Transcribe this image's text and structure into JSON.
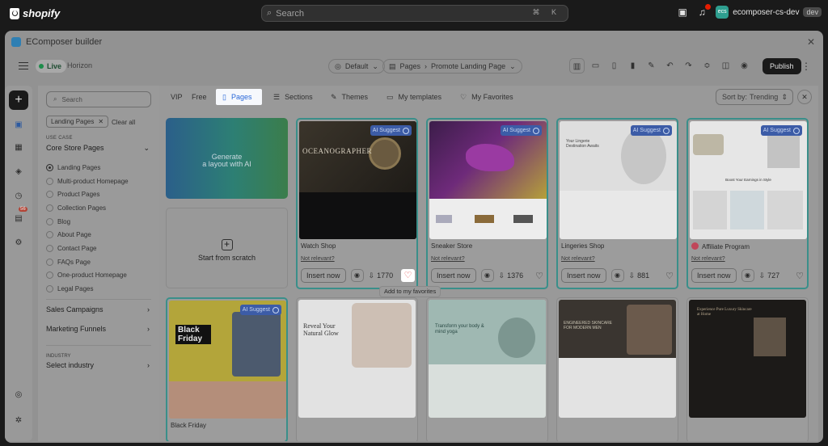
{
  "topbar": {
    "brand": "shopify",
    "search_placeholder": "Search",
    "kbd": "⌘ K",
    "account_name": "ecomposer-cs-dev",
    "account_avatar": "ecs",
    "account_tag": "dev"
  },
  "modal": {
    "title": "EComposer builder",
    "live_label": "Live",
    "theme_name": "Horizon",
    "device_label": "Default",
    "page_type": "Pages",
    "page_name": "Promote Landing Page",
    "publish_label": "Publish"
  },
  "rail": {
    "badge": "56"
  },
  "panel": {
    "search_placeholder": "Search",
    "chip_label": "Landing Pages",
    "clear_all": "Clear all",
    "use_case_label": "USE CASE",
    "group_title": "Core Store Pages",
    "options": [
      "Landing Pages",
      "Multi-product Homepage",
      "Product Pages",
      "Collection Pages",
      "Blog",
      "About Page",
      "Contact Page",
      "FAQs Page",
      "One-product Homepage",
      "Legal Pages"
    ],
    "selected_index": 0,
    "sales_campaigns": "Sales Campaigns",
    "marketing_funnels": "Marketing Funnels",
    "industry_label": "INDUSTRY",
    "select_industry": "Select industry"
  },
  "tabs": {
    "vip": "VIP",
    "free": "Free",
    "pages": "Pages",
    "sections": "Sections",
    "themes": "Themes",
    "my_templates": "My templates",
    "my_favorites": "My Favorites",
    "sort_label": "Sort by:",
    "sort_value": "Trending"
  },
  "generate": {
    "line1": "Generate",
    "line2": "a layout with AI"
  },
  "scratch": {
    "label": "Start from scratch"
  },
  "ai_suggest": "AI Suggest",
  "insert_label": "Insert now",
  "not_relevant": "Not relevant?",
  "tooltip": "Add to my favorites",
  "cards": [
    {
      "name": "Watch Shop",
      "downloads": "1770",
      "thumb_text": "OCEANOGRAPHER"
    },
    {
      "name": "Sneaker Store",
      "downloads": "1376"
    },
    {
      "name": "Lingeries Shop",
      "downloads": "881",
      "thumb_text": "Your Lingerie Destination Awaits"
    },
    {
      "name": "Affiliate Program",
      "downloads": "727",
      "thumb_text": "Boost Your Earnings in Style"
    },
    {
      "name": "Black Friday",
      "thumb_text": "Black Friday"
    },
    {
      "thumb_text": "Reveal Your Natural Glow"
    },
    {
      "thumb_text": "Transform your body & mind yoga"
    },
    {
      "thumb_text": "ENGINEERED SKINCARE FOR MODERN MEN"
    },
    {
      "thumb_text": "Experience Pure Luxury Skincare at Home"
    }
  ]
}
